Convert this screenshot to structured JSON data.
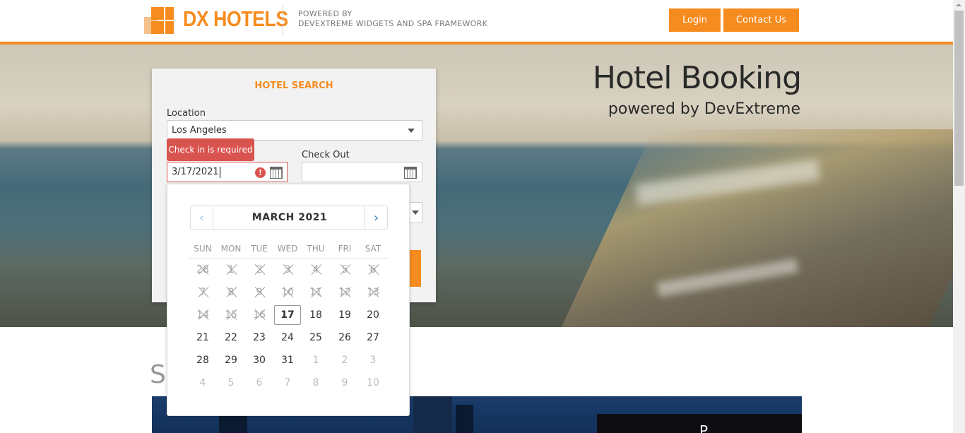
{
  "header": {
    "brand": "DX HOTELS",
    "powered_line1": "POWERED BY",
    "powered_line2": "DEVEXTREME WIDGETS AND SPA FRAMEWORK",
    "login_label": "Login",
    "contact_label": "Contact Us",
    "accent_color": "#f68c1f"
  },
  "hero": {
    "title": "Hotel Booking",
    "subtitle": "powered by DevExtreme"
  },
  "search": {
    "title": "HOTEL SEARCH",
    "location_label": "Location",
    "location_value": "Los Angeles",
    "check_in_value": "3/17/2021",
    "check_in_error": "Check in is required",
    "check_out_label": "Check Out",
    "check_out_value": ""
  },
  "calendar": {
    "caption": "MARCH 2021",
    "weekdays": [
      "SUN",
      "MON",
      "TUE",
      "WED",
      "THU",
      "FRI",
      "SAT"
    ],
    "weeks": [
      [
        {
          "d": "28",
          "s": "disabled"
        },
        {
          "d": "1",
          "s": "disabled"
        },
        {
          "d": "2",
          "s": "disabled"
        },
        {
          "d": "3",
          "s": "disabled"
        },
        {
          "d": "4",
          "s": "disabled"
        },
        {
          "d": "5",
          "s": "disabled"
        },
        {
          "d": "6",
          "s": "disabled"
        }
      ],
      [
        {
          "d": "7",
          "s": "disabled"
        },
        {
          "d": "8",
          "s": "disabled"
        },
        {
          "d": "9",
          "s": "disabled"
        },
        {
          "d": "10",
          "s": "disabled"
        },
        {
          "d": "11",
          "s": "disabled"
        },
        {
          "d": "12",
          "s": "disabled"
        },
        {
          "d": "13",
          "s": "disabled"
        }
      ],
      [
        {
          "d": "14",
          "s": "disabled"
        },
        {
          "d": "15",
          "s": "disabled"
        },
        {
          "d": "16",
          "s": "disabled"
        },
        {
          "d": "17",
          "s": "selected"
        },
        {
          "d": "18",
          "s": ""
        },
        {
          "d": "19",
          "s": ""
        },
        {
          "d": "20",
          "s": ""
        }
      ],
      [
        {
          "d": "21",
          "s": ""
        },
        {
          "d": "22",
          "s": ""
        },
        {
          "d": "23",
          "s": ""
        },
        {
          "d": "24",
          "s": ""
        },
        {
          "d": "25",
          "s": ""
        },
        {
          "d": "26",
          "s": ""
        },
        {
          "d": "27",
          "s": ""
        }
      ],
      [
        {
          "d": "28",
          "s": ""
        },
        {
          "d": "29",
          "s": ""
        },
        {
          "d": "30",
          "s": ""
        },
        {
          "d": "31",
          "s": ""
        },
        {
          "d": "1",
          "s": "other"
        },
        {
          "d": "2",
          "s": "other"
        },
        {
          "d": "3",
          "s": "other"
        }
      ],
      [
        {
          "d": "4",
          "s": "other"
        },
        {
          "d": "5",
          "s": "other"
        },
        {
          "d": "6",
          "s": "other"
        },
        {
          "d": "7",
          "s": "other"
        },
        {
          "d": "8",
          "s": "other"
        },
        {
          "d": "9",
          "s": "other"
        },
        {
          "d": "10",
          "s": "other"
        }
      ]
    ]
  },
  "below": {
    "section_title_partial": "S",
    "card_text_partial": "P"
  }
}
